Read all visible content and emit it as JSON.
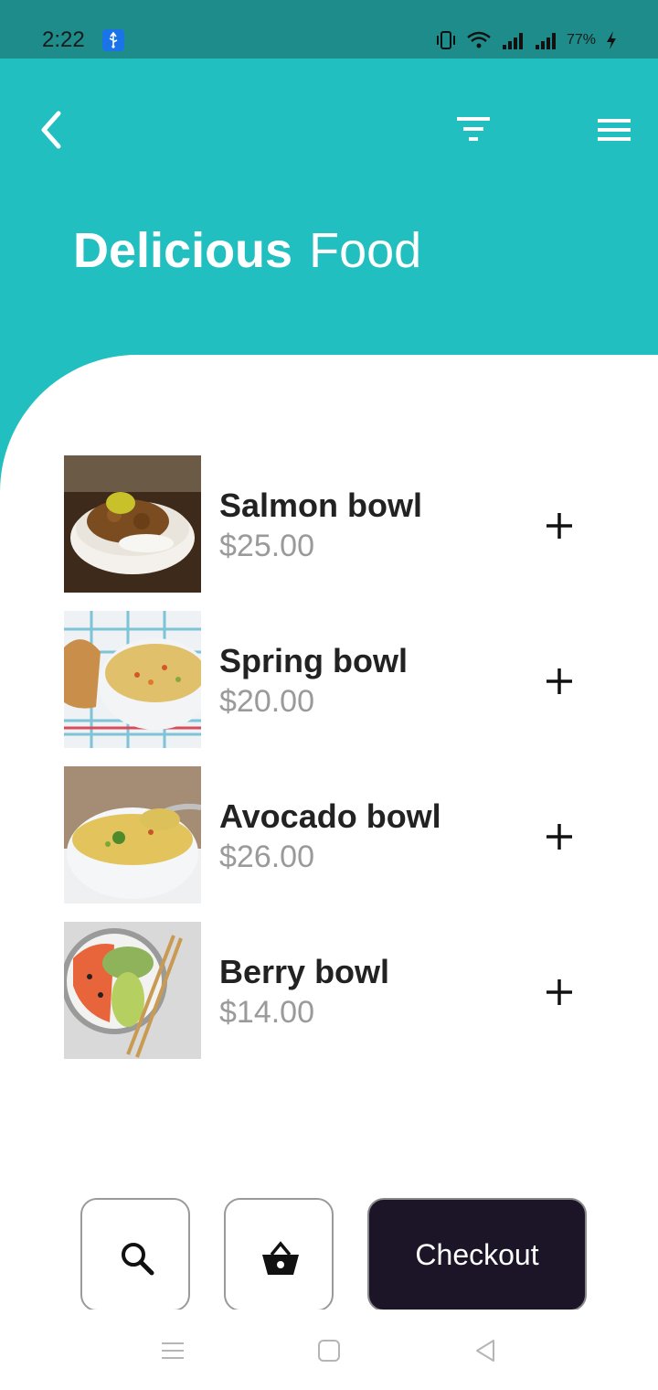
{
  "status_bar": {
    "time": "2:22",
    "battery": "77%",
    "icons": [
      "usb-icon",
      "vibrate-icon",
      "wifi-icon",
      "signal-icon",
      "signal-icon",
      "charging-icon"
    ]
  },
  "header": {
    "title_bold": "Delicious",
    "title_light": "Food",
    "background_color": "#21bfbf",
    "icons": [
      "back-arrow-icon",
      "filter-icon",
      "hamburger-menu-icon"
    ]
  },
  "items": [
    {
      "name": "Salmon bowl",
      "price": "$25.00",
      "image": "rice-bowl-with-meat"
    },
    {
      "name": "Spring bowl",
      "price": "$20.00",
      "image": "soup-bowl-with-bread"
    },
    {
      "name": "Avocado bowl",
      "price": "$26.00",
      "image": "soup-bowl-with-spoon"
    },
    {
      "name": "Berry bowl",
      "price": "$14.00",
      "image": "poke-bowl-salmon-avocado"
    }
  ],
  "actions": {
    "checkout_label": "Checkout",
    "search_icon": "search-icon",
    "basket_icon": "basket-icon"
  },
  "colors": {
    "accent": "#21bfbf",
    "status_bar": "#1e8c8a",
    "checkout_bg": "#1c1528",
    "price_text": "#9a9a9a"
  },
  "nav_bar": {
    "icons": [
      "recent-apps-icon",
      "home-icon",
      "back-icon"
    ]
  }
}
